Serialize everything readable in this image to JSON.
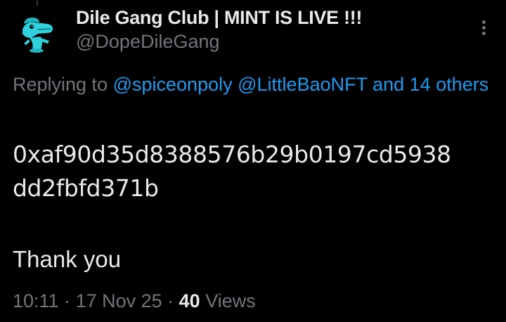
{
  "author": {
    "display_name": "Dile Gang Club | MINT IS LIVE !!!",
    "handle": "@DopeDileGang",
    "avatar_icon": "crocodile-avatar-icon",
    "avatar_color": "#2ed1dc"
  },
  "reply_context": {
    "prefix": "Replying to ",
    "mentions": [
      "@spiceonpoly",
      "@LittleBaoNFT"
    ],
    "connector": " and ",
    "others": "14 others"
  },
  "tweet": {
    "text_lines": [
      "0xaf90d35d8388576b29b0197cd5938",
      "dd2fbfd371b"
    ],
    "closing": "Thank you"
  },
  "meta": {
    "time": "10:11",
    "separator": " · ",
    "date": "17 Nov 25",
    "views_count": "40",
    "views_label": " Views"
  },
  "colors": {
    "background": "#000000",
    "text_primary": "#e7e9ea",
    "text_secondary": "#71767b",
    "link": "#1d9bf0"
  },
  "icons": {
    "more": "more-vertical-icon"
  }
}
